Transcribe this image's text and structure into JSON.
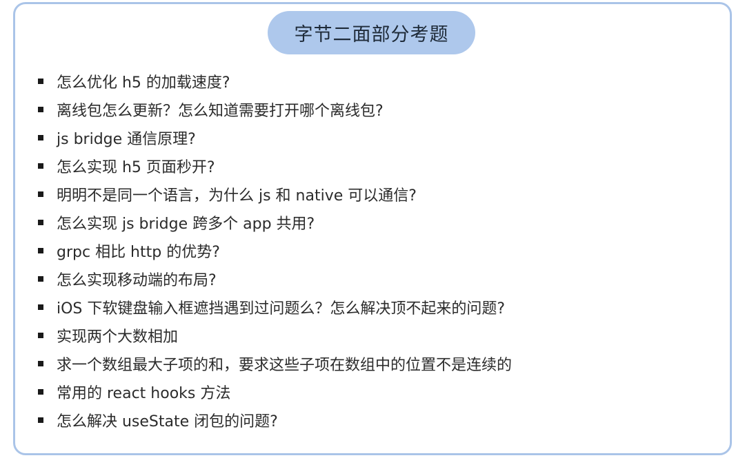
{
  "title": "字节二面部分考题",
  "questions": [
    "怎么优化 h5 的加载速度?",
    "离线包怎么更新？怎么知道需要打开哪个离线包?",
    "js bridge 通信原理?",
    "怎么实现 h5 页面秒开?",
    "明明不是同一个语言，为什么 js 和 native 可以通信?",
    "怎么实现 js bridge 跨多个 app 共用?",
    "grpc 相比 http 的优势?",
    "怎么实现移动端的布局?",
    "iOS 下软键盘输入框遮挡遇到过问题么？怎么解决顶不起来的问题?",
    "实现两个大数相加",
    "求一个数组最大子项的和，要求这些子项在数组中的位置不是连续的",
    "常用的 react hooks 方法",
    "怎么解决 useState 闭包的问题?"
  ],
  "colors": {
    "border": "#aac4e8",
    "title_background": "#aec8ec",
    "text": "#2b2b2b",
    "bullet": "#1a1a1a"
  },
  "icons": {
    "bullet": "square-bullet-icon"
  }
}
